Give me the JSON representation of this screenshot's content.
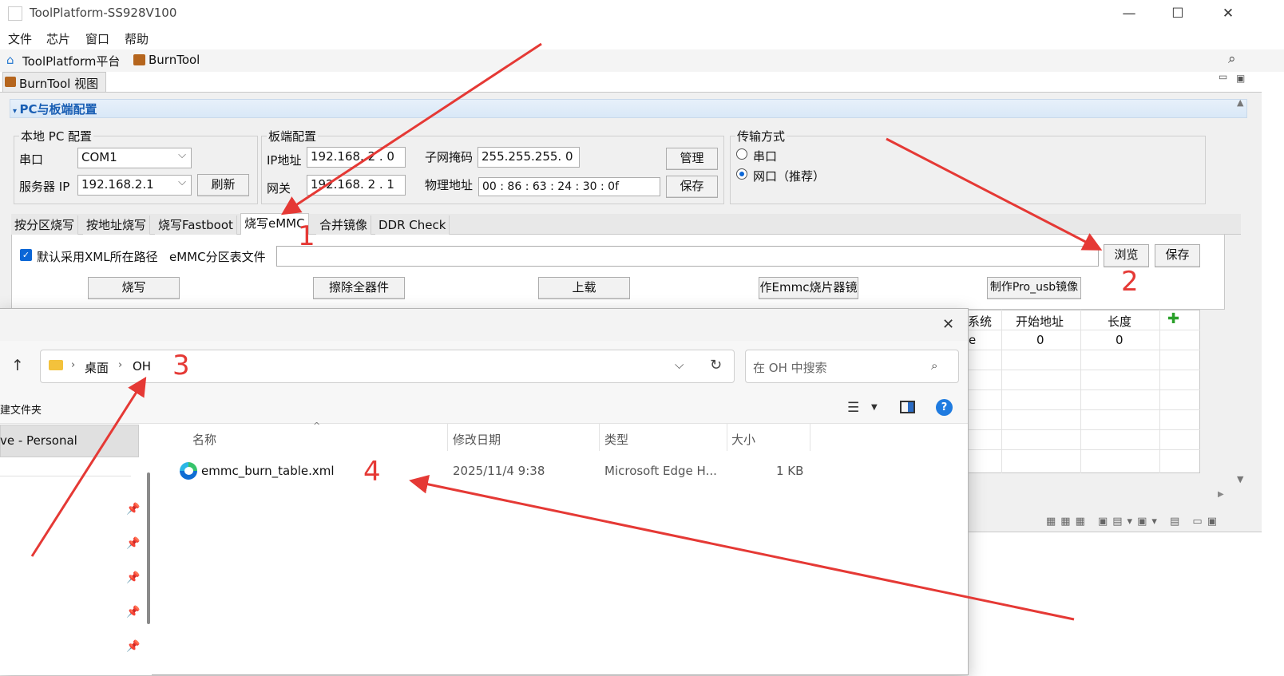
{
  "window": {
    "title": "ToolPlatform-SS928V100",
    "min": "—",
    "max": "☐",
    "close": "✕"
  },
  "menu": [
    "文件",
    "芯片",
    "窗口",
    "帮助"
  ],
  "toolbar": {
    "item1": "ToolPlatform平台",
    "item2": "BurnTool"
  },
  "view_tab": "BurnTool 视图",
  "section_title": "PC与板端配置",
  "pc_config": {
    "legend": "本地 PC 配置",
    "serial_label": "串口",
    "serial_value": "COM1",
    "server_ip_label": "服务器 IP",
    "server_ip_value": "192.168.2.1",
    "refresh_button": "刷新"
  },
  "board_config": {
    "legend": "板端配置",
    "ip_label": "IP地址",
    "ip_value": "192.168. 2 . 0",
    "gateway_label": "网关",
    "gateway_value": "192.168. 2 . 1",
    "mask_label": "子网掩码",
    "mask_value": "255.255.255. 0",
    "mac_label": "物理地址",
    "mac_value": "00 : 86 : 63 : 24 : 30 : 0f",
    "manage_button": "管理",
    "save_button": "保存"
  },
  "transfer": {
    "legend": "传输方式",
    "opt_serial": "串口",
    "opt_network": "网口（推荐）"
  },
  "tabs": [
    "按分区烧写",
    "按地址烧写",
    "烧写Fastboot",
    "烧写eMMC",
    "合并镜像",
    "DDR Check"
  ],
  "emmc": {
    "checkbox_label": "默认采用XML所在路径",
    "table_file_label": "eMMC分区表文件",
    "file_path": "",
    "browse_button": "浏览",
    "save_button": "保存",
    "burn_button": "烧写",
    "erase_button": "擦除全器件",
    "upload_button": "上载",
    "make_emmc_button": "作Emmc烧片器镜",
    "make_usb_button": "制作Pro_usb镜像"
  },
  "grid": {
    "headers": [
      "系统",
      "开始地址",
      "长度"
    ],
    "row1": [
      "e",
      "0",
      "0"
    ],
    "add": "✚"
  },
  "dialog": {
    "close": "✕",
    "up_arrow": "↑",
    "breadcrumb_desktop": "桌面",
    "breadcrumb_folder": "OH",
    "search_placeholder": "在 OH 中搜索",
    "new_folder": "建文件夹",
    "nav_selected": "ve - Personal",
    "columns": [
      "名称",
      "修改日期",
      "类型",
      "大小"
    ],
    "file": {
      "name": "emmc_burn_table.xml",
      "date": "2025/11/4 9:38",
      "type": "Microsoft Edge H...",
      "size": "1 KB"
    }
  },
  "annotations": [
    "1",
    "2",
    "3",
    "4"
  ],
  "colors": {
    "accent": "#0b66d6",
    "arrow": "#e53935",
    "section": "#1a5fb4"
  }
}
